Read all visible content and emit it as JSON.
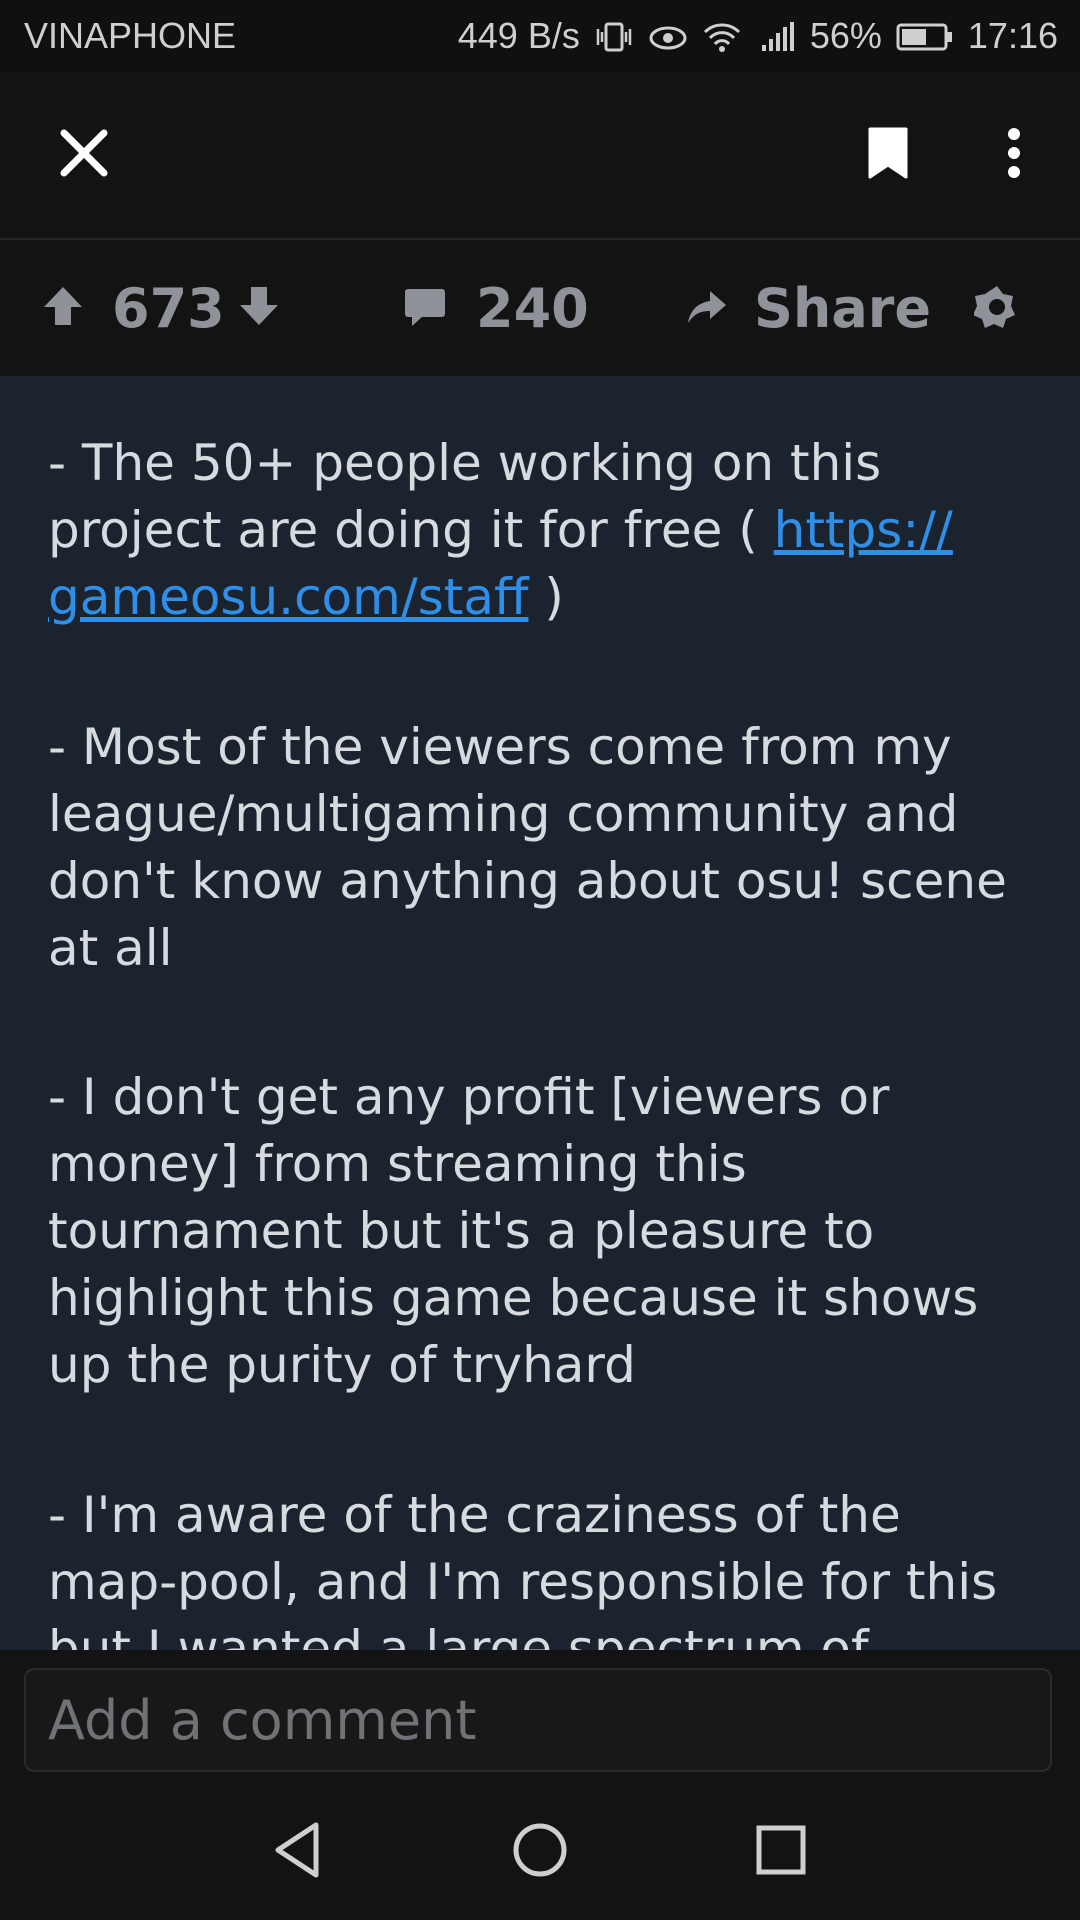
{
  "status_bar": {
    "carrier": "VINAPHONE",
    "net_speed": "449 B/s",
    "battery": "56%",
    "time": "17:16"
  },
  "toolbar": {
    "close_icon": "close-icon",
    "bookmark_icon": "bookmark-icon",
    "more_icon": "more-vertical-icon"
  },
  "actions": {
    "score": "673",
    "comments": "240",
    "share_label": "Share"
  },
  "post": {
    "p1_text": "- The 50+ people working on this project are doing it for free ( ",
    "p1_link": "https://gameosu.com/staff",
    "p1_link_display_a": "https://",
    "p1_link_display_b": "gameosu.com/staff",
    "p1_tail": " )",
    "p2": "- Most of the viewers come from my league/multigaming community and don't know anything about osu! scene at all",
    "p3": "- I don't get any profit [viewers or money] from streaming this tournament but it's a pleasure to highlight this game because it shows up the purity of tryhard",
    "p4": "- I'm aware of the craziness of the map-pool, and I'm responsible for this but I wanted a large spectrum of"
  },
  "comment": {
    "placeholder": "Add a comment"
  },
  "colors": {
    "background": "#1b242e",
    "bar": "#131313",
    "link": "#2f8fe8",
    "muted": "#8f9399"
  }
}
